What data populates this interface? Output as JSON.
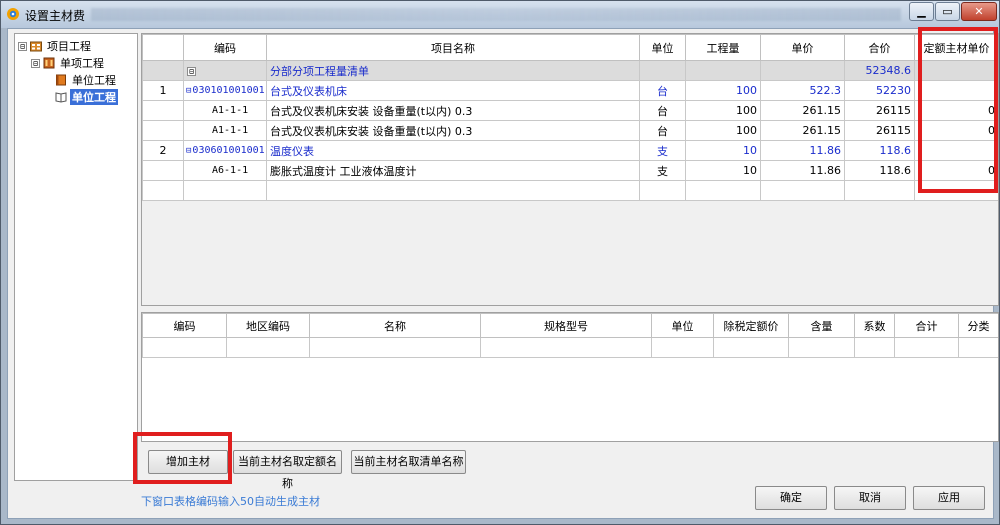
{
  "window": {
    "title": "设置主材费",
    "controls": {
      "minimize": "▁",
      "maximize": "▭",
      "close": "✕"
    }
  },
  "tree": {
    "items": [
      {
        "label": "项目工程",
        "expander": "⊟",
        "icon": "project-icon"
      },
      {
        "label": "单项工程",
        "expander": "⊟",
        "icon": "building-icon"
      },
      {
        "label": "单位工程",
        "icon": "book-icon"
      },
      {
        "label": "单位工程",
        "icon": "book-open-icon",
        "selected": true
      }
    ]
  },
  "main_table": {
    "headers": [
      "",
      "编码",
      "项目名称",
      "单位",
      "工程量",
      "单价",
      "合价",
      "定额主材单价"
    ],
    "rows": [
      {
        "num": "",
        "code": "",
        "name": "分部分项工程量清单",
        "unit": "",
        "qty": "",
        "price": "",
        "total": "52348.6",
        "main_price": "",
        "type": "group",
        "expander": "⊟"
      },
      {
        "num": "1",
        "code": "030101001001",
        "name": "台式及仪表机床",
        "unit": "台",
        "qty": "100",
        "price": "522.3",
        "total": "52230",
        "main_price": "",
        "type": "item",
        "expander": "⊟"
      },
      {
        "num": "",
        "code": "A1-1-1",
        "name": "台式及仪表机床安装 设备重量(t以内) 0.3",
        "unit": "台",
        "qty": "100",
        "price": "261.15",
        "total": "26115",
        "main_price": "0",
        "type": "sub"
      },
      {
        "num": "",
        "code": "A1-1-1",
        "name": "台式及仪表机床安装 设备重量(t以内) 0.3",
        "unit": "台",
        "qty": "100",
        "price": "261.15",
        "total": "26115",
        "main_price": "0",
        "type": "sub"
      },
      {
        "num": "2",
        "code": "030601001001",
        "name": "温度仪表",
        "unit": "支",
        "qty": "10",
        "price": "11.86",
        "total": "118.6",
        "main_price": "",
        "type": "item",
        "expander": "⊟"
      },
      {
        "num": "",
        "code": "A6-1-1",
        "name": "膨胀式温度计 工业液体温度计",
        "unit": "支",
        "qty": "10",
        "price": "11.86",
        "total": "118.6",
        "main_price": "0",
        "type": "sub"
      }
    ]
  },
  "material_table": {
    "headers": [
      "编码",
      "地区编码",
      "名称",
      "规格型号",
      "单位",
      "除税定额价",
      "含量",
      "系数",
      "合计",
      "分类"
    ]
  },
  "buttons": {
    "add_material": "增加主材",
    "name_from_quota": "当前主材名取定额名称",
    "name_from_list": "当前主材名取清单名称",
    "ok": "确定",
    "cancel": "取消",
    "apply": "应用"
  },
  "hint": "下窗口表格编码输入50自动生成主材",
  "colors": {
    "highlight": "#e01e1e",
    "link_blue": "#1a2ccc",
    "hint_blue": "#3a7bd5",
    "selected": "#3a6fd8"
  }
}
